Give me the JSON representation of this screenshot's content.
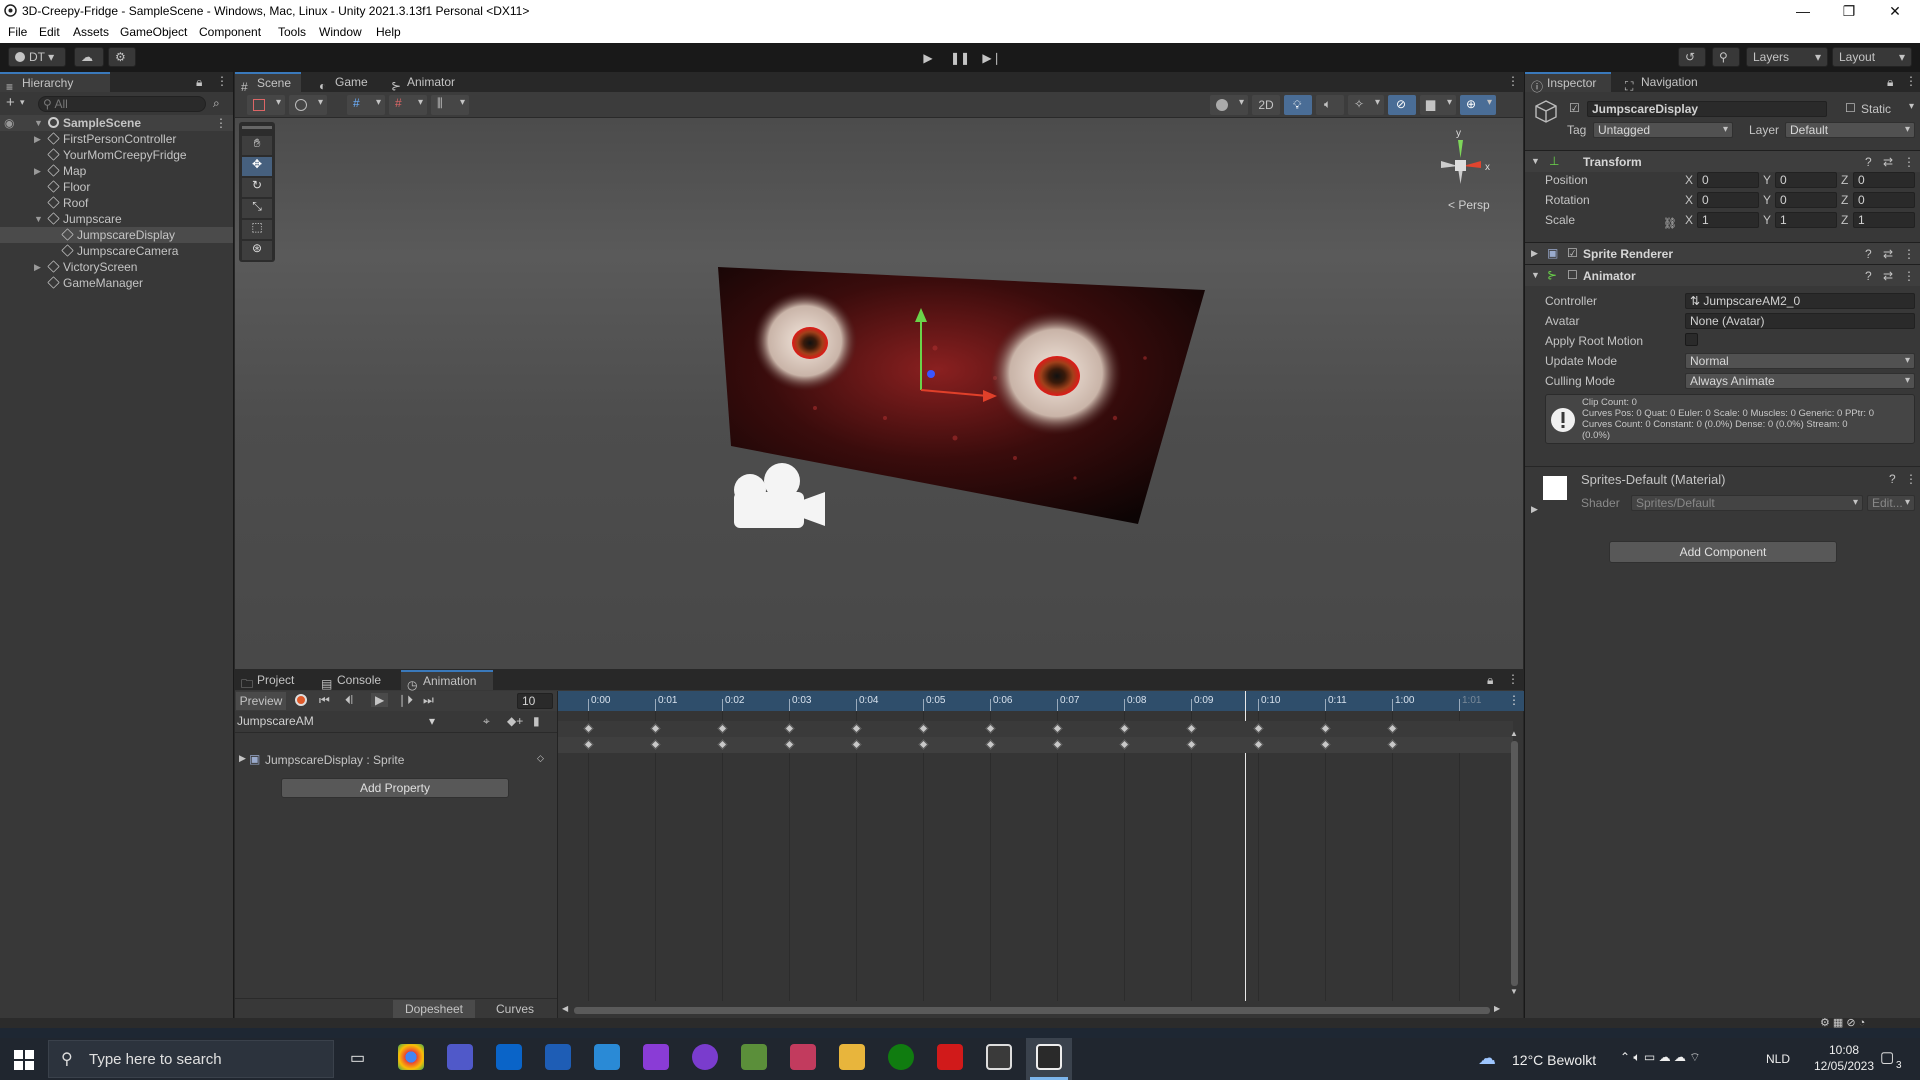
{
  "window": {
    "title": "3D-Creepy-Fridge - SampleScene - Windows, Mac, Linux - Unity 2021.3.13f1 Personal <DX11>"
  },
  "menu": [
    "File",
    "Edit",
    "Assets",
    "GameObject",
    "Component",
    "Tools",
    "Window",
    "Help"
  ],
  "toolbar": {
    "account": "DT",
    "layers": "Layers",
    "layout": "Layout"
  },
  "hierarchy": {
    "tab": "Hierarchy",
    "search_placeholder": "All",
    "scene": "SampleScene",
    "items": [
      {
        "label": "FirstPersonController",
        "depth": 1,
        "expandable": true
      },
      {
        "label": "YourMomCreepyFridge",
        "depth": 1,
        "expandable": false
      },
      {
        "label": "Map",
        "depth": 1,
        "expandable": true
      },
      {
        "label": "Floor",
        "depth": 1,
        "expandable": false
      },
      {
        "label": "Roof",
        "depth": 1,
        "expandable": false
      },
      {
        "label": "Jumpscare",
        "depth": 1,
        "expandable": true
      },
      {
        "label": "JumpscareDisplay",
        "depth": 2,
        "expandable": false,
        "selected": true
      },
      {
        "label": "JumpscareCamera",
        "depth": 2,
        "expandable": false
      },
      {
        "label": "VictoryScreen",
        "depth": 1,
        "expandable": true
      },
      {
        "label": "GameManager",
        "depth": 1,
        "expandable": false
      }
    ]
  },
  "scene": {
    "tabs": [
      "Scene",
      "Game",
      "Animator"
    ],
    "mode_2d": "2D",
    "persp": "Persp",
    "gizmo_y": "y",
    "gizmo_x": "x"
  },
  "inspector": {
    "tabs": [
      "Inspector",
      "Navigation"
    ],
    "object_name": "JumpscareDisplay",
    "static": "Static",
    "tag_label": "Tag",
    "tag_value": "Untagged",
    "layer_label": "Layer",
    "layer_value": "Default",
    "transform": {
      "title": "Transform",
      "position": {
        "label": "Position",
        "x": "0",
        "y": "0",
        "z": "0"
      },
      "rotation": {
        "label": "Rotation",
        "x": "0",
        "y": "0",
        "z": "0"
      },
      "scale": {
        "label": "Scale",
        "x": "1",
        "y": "1",
        "z": "1"
      }
    },
    "sprite_renderer": "Sprite Renderer",
    "animator": {
      "title": "Animator",
      "controller_label": "Controller",
      "controller_value": "JumpscareAM2_0",
      "avatar_label": "Avatar",
      "avatar_value": "None (Avatar)",
      "apply_root_label": "Apply Root Motion",
      "update_label": "Update Mode",
      "update_value": "Normal",
      "culling_label": "Culling Mode",
      "culling_value": "Always Animate",
      "info1": "Clip Count: 0",
      "info2": "Curves Pos: 0 Quat: 0 Euler: 0 Scale: 0 Muscles: 0 Generic: 0 PPtr: 0",
      "info3": "Curves Count: 0 Constant: 0 (0.0%) Dense: 0 (0.0%) Stream: 0",
      "info4": "(0.0%)"
    },
    "material": {
      "name": "Sprites-Default (Material)",
      "shader_label": "Shader",
      "shader_value": "Sprites/Default",
      "edit": "Edit..."
    },
    "add_component": "Add Component"
  },
  "animation": {
    "tabs": [
      "Project",
      "Console",
      "Animation"
    ],
    "preview": "Preview",
    "frame": "10",
    "clip": "JumpscareAM",
    "property": "JumpscareDisplay : Sprite",
    "add_property": "Add Property",
    "ticks": [
      "0:00",
      "0:01",
      "0:02",
      "0:03",
      "0:04",
      "0:05",
      "0:06",
      "0:07",
      "0:08",
      "0:09",
      "0:10",
      "0:11",
      "1:00",
      "1:01"
    ],
    "keyframe_count": 13,
    "dopesheet": "Dopesheet",
    "curves": "Curves"
  },
  "taskbar": {
    "search_placeholder": "Type here to search",
    "weather": "12°C  Bewolkt",
    "lang": "NLD",
    "time": "10:08",
    "date": "12/05/2023",
    "notif": "3"
  }
}
